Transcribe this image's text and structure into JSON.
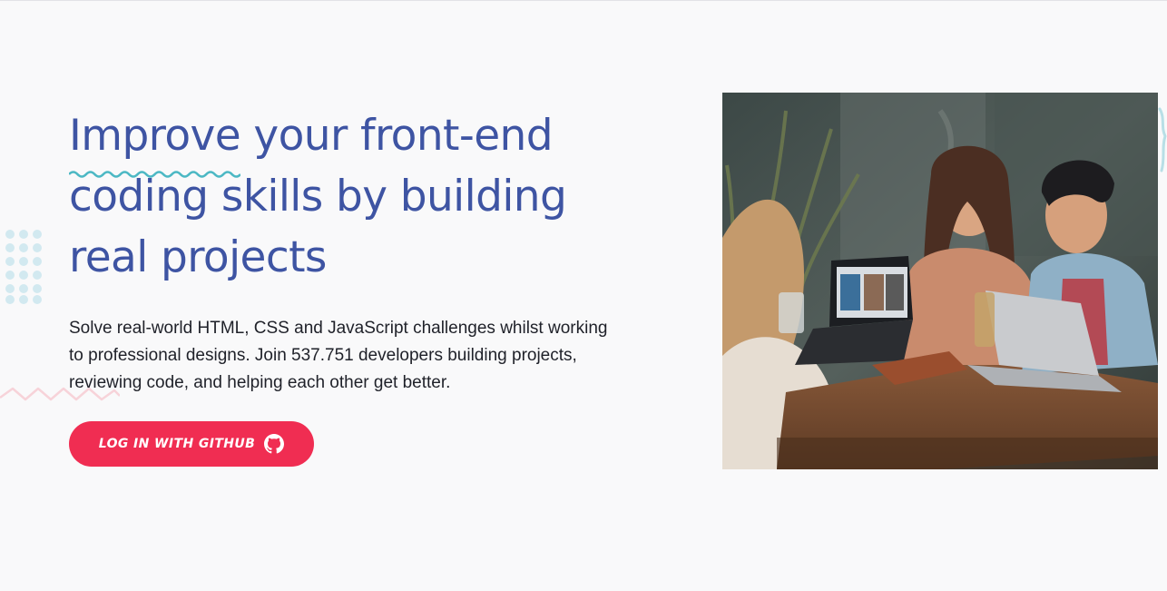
{
  "hero": {
    "headline": {
      "emphasis": "Improve",
      "line1_rest": " your front-end",
      "line2": "coding skills by building",
      "line3": "real projects"
    },
    "subtext": "Solve real-world HTML, CSS and JavaScript challenges whilst working to professional designs. Join 537.751 developers building projects, reviewing code, and helping each other get better.",
    "cta": {
      "label": "LOG IN WITH GITHUB",
      "icon": "github-icon"
    },
    "photo": {
      "alt": "three-people-laughing-at-cafe-table-with-laptops"
    }
  },
  "colors": {
    "background": "#f9f9fa",
    "headline": "#3e54a3",
    "body_text": "#1f2129",
    "cta_background": "#f02d52",
    "squiggle": "#4cb8c4",
    "dots": "#d2e9f0",
    "zigzag": "#f7d3d9"
  }
}
